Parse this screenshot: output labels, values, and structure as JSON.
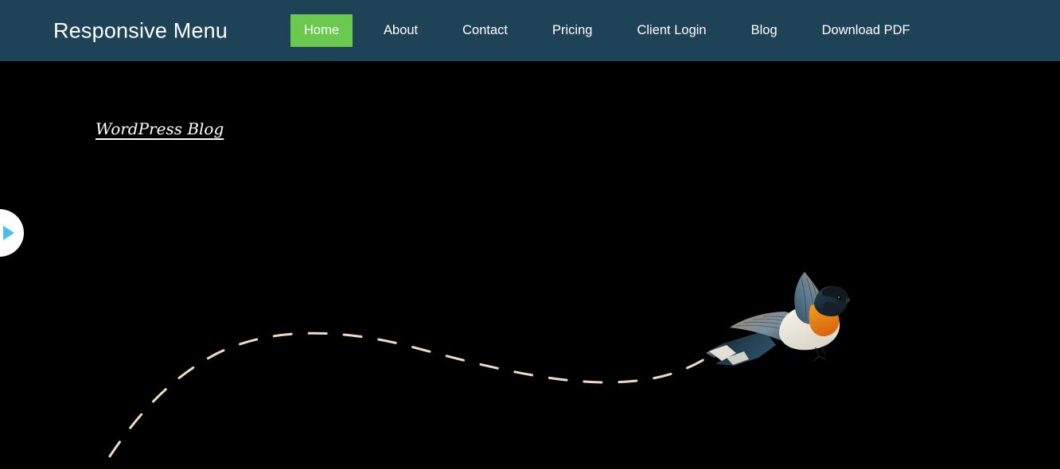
{
  "header": {
    "brand_title": "Responsive Menu",
    "background_color": "#1e4357",
    "nav": {
      "active_background": "#6ac94e",
      "text_color": "#ffffff",
      "items": [
        {
          "label": "Home",
          "active": true
        },
        {
          "label": "About",
          "active": false
        },
        {
          "label": "Contact",
          "active": false
        },
        {
          "label": "Pricing",
          "active": false
        },
        {
          "label": "Client Login",
          "active": false
        },
        {
          "label": "Blog",
          "active": false
        },
        {
          "label": "Download PDF",
          "active": false
        }
      ]
    }
  },
  "hero": {
    "background_color": "#000000",
    "blog_link": {
      "label": "WordPress Blog",
      "color": "#ffffff"
    },
    "play_button": {
      "icon": "play-icon",
      "circle_color": "#ffffff",
      "triangle_color": "#4cbdf0"
    },
    "flight_trail": {
      "icon": "dashed-trail",
      "color": "#f0dcc3",
      "stroke_width": 3,
      "dash_pattern": "22 22"
    },
    "bird": {
      "icon": "flying-bird-illustration",
      "plumage": {
        "throat": "#e8801a",
        "wing": "#3c5d73",
        "wing_highlight": "#8e9aa6",
        "wing_tan": "#a08a6a",
        "belly": "#f2efe6",
        "head": "#1d2a36",
        "beak": "#2b2b2b",
        "eye": "#1a1a1a"
      }
    }
  }
}
